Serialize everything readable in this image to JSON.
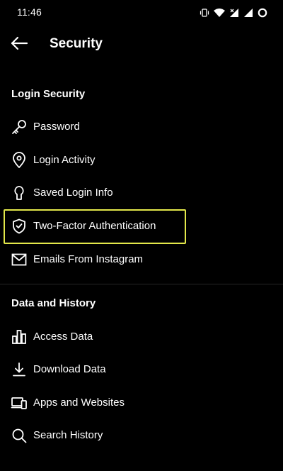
{
  "status_bar": {
    "time": "11:46",
    "icons": [
      "vibrate-icon",
      "wifi-icon",
      "signal-x-icon",
      "signal-icon",
      "battery-ring-icon"
    ]
  },
  "header": {
    "title": "Security",
    "back_icon": "arrow-left-icon"
  },
  "sections": [
    {
      "title": "Login Security",
      "items": [
        {
          "label": "Password",
          "icon": "key-icon"
        },
        {
          "label": "Login Activity",
          "icon": "location-pin-icon"
        },
        {
          "label": "Saved Login Info",
          "icon": "keyhole-icon"
        },
        {
          "label": "Two-Factor Authentication",
          "icon": "shield-check-icon",
          "highlighted": true
        },
        {
          "label": "Emails From Instagram",
          "icon": "mail-icon"
        }
      ]
    },
    {
      "title": "Data and History",
      "items": [
        {
          "label": "Access Data",
          "icon": "bar-chart-icon"
        },
        {
          "label": "Download Data",
          "icon": "download-icon"
        },
        {
          "label": "Apps and Websites",
          "icon": "devices-icon"
        },
        {
          "label": "Search History",
          "icon": "search-icon"
        }
      ]
    }
  ],
  "colors": {
    "background": "#000000",
    "text": "#ffffff",
    "highlight": "#e3e84a"
  }
}
